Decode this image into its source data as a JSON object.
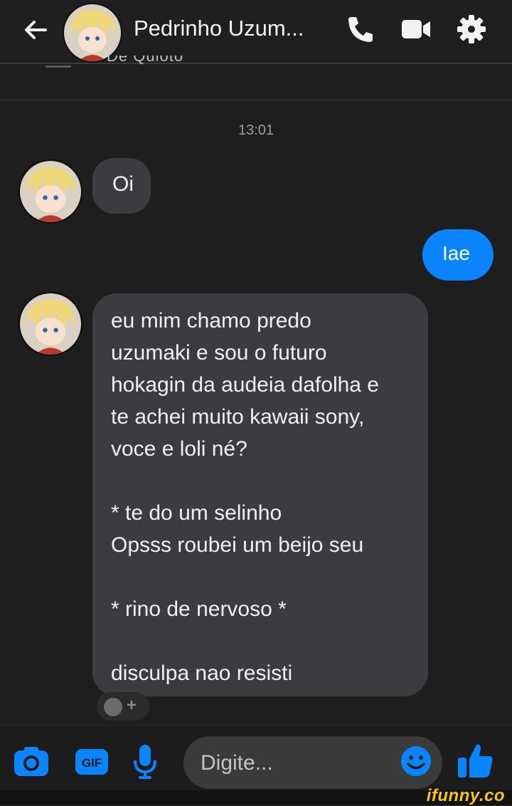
{
  "header": {
    "contact_name": "Pedrinho Uzum...",
    "subtitle_partial": "De Quioto",
    "icons": [
      "back-arrow-icon",
      "phone-icon",
      "video-camera-icon",
      "gear-icon"
    ]
  },
  "conversation": {
    "timestamp": "13:01",
    "messages": [
      {
        "sender": "contact",
        "text": "Oi"
      },
      {
        "sender": "me",
        "text": "Iae"
      },
      {
        "sender": "contact",
        "text": "eu mim chamo predo\nuzumaki e sou o futuro\nhokagin da audeia dafolha e\nte achei muito kawaii sony,\nvoce e loli né?\n\n* te do um selinho\nOpsss roubei um beijo seu\n\n* rino de nervoso *\n\ndisculpa nao resisti"
      }
    ],
    "reaction_add": "+"
  },
  "composer": {
    "placeholder": "Digite...",
    "value": "",
    "icons": [
      "camera-icon",
      "gif-icon",
      "microphone-icon",
      "emoji-icon",
      "thumbs-up-icon"
    ],
    "gif_label": "GIF"
  },
  "watermark": "ifunny.co",
  "colors": {
    "background": "#1e1e1e",
    "incoming_bubble": "#3a3c3f",
    "outgoing_bubble": "#0a84ff",
    "accent": "#0a84ff"
  }
}
